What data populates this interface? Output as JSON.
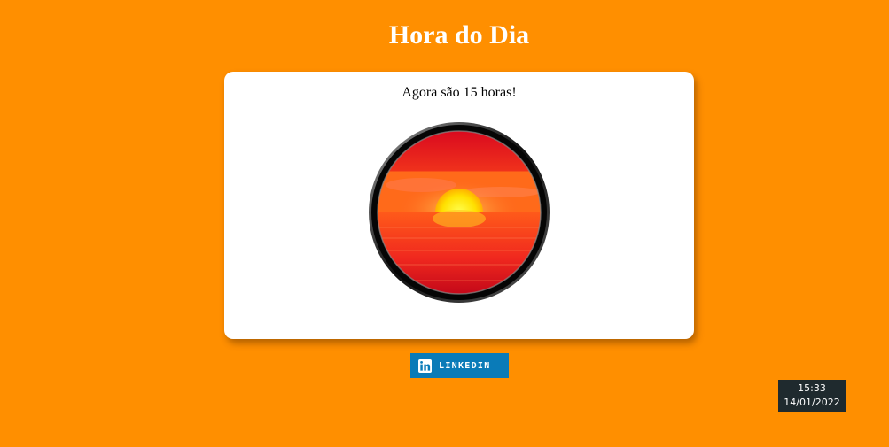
{
  "header": {
    "title": "Hora do Dia"
  },
  "card": {
    "message": "Agora são 15 horas!",
    "image_icon": "sunset-image"
  },
  "linkedin": {
    "label": "LINKEDIN",
    "icon": "linkedin-icon",
    "color": "#0a7bb8"
  },
  "clock": {
    "time": "15:33",
    "date": "14/01/2022"
  },
  "colors": {
    "background": "#ff8f00",
    "card": "#ffffff",
    "clock_bg": "#1f2a2e"
  }
}
